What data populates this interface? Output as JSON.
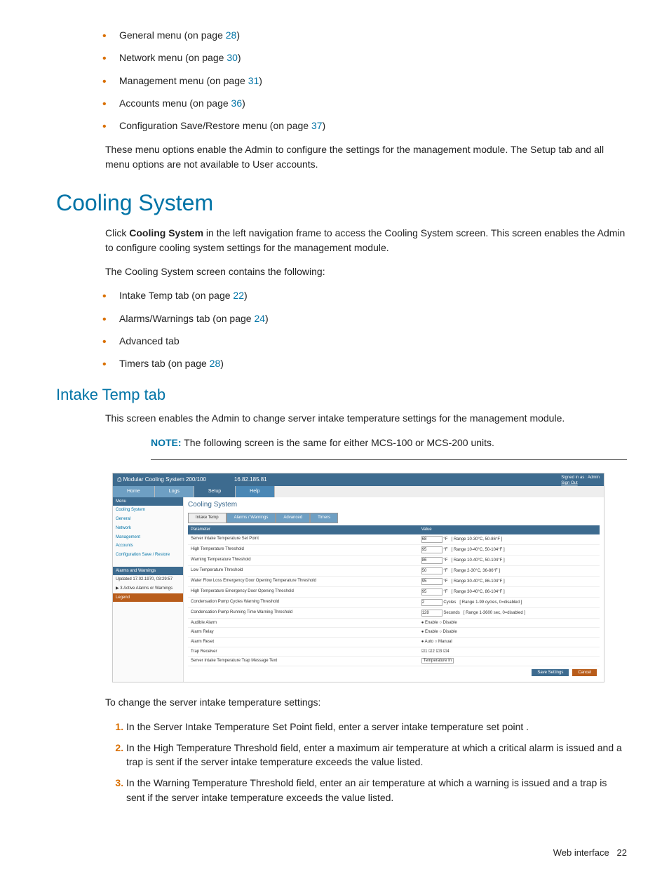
{
  "top_menus": [
    {
      "prefix": "General menu (on page ",
      "page": "28",
      "suffix": ")"
    },
    {
      "prefix": "Network menu (on page ",
      "page": "30",
      "suffix": ")"
    },
    {
      "prefix": "Management menu (on page ",
      "page": "31",
      "suffix": ")"
    },
    {
      "prefix": "Accounts menu (on page ",
      "page": "36",
      "suffix": ")"
    },
    {
      "prefix": "Configuration Save/Restore menu (on page ",
      "page": "37",
      "suffix": ")"
    }
  ],
  "top_para": "These menu options enable the Admin to configure the settings for the management module. The Setup tab and all menu options are not available to User accounts.",
  "h1": "Cooling System",
  "cs_p1_pre": "Click ",
  "cs_p1_bold": "Cooling System",
  "cs_p1_post": " in the left navigation frame to access the Cooling System screen. This screen enables the Admin to configure cooling system settings for the management module.",
  "cs_p2": "The Cooling System screen contains the following:",
  "cs_list": [
    {
      "prefix": "Intake Temp tab (on page ",
      "page": "22",
      "suffix": ")"
    },
    {
      "prefix": "Alarms/Warnings tab (on page ",
      "page": "24",
      "suffix": ")"
    },
    {
      "prefix": "Advanced tab",
      "page": "",
      "suffix": ""
    },
    {
      "prefix": "Timers tab (on page ",
      "page": "28",
      "suffix": ")"
    }
  ],
  "h2": "Intake Temp tab",
  "it_p1": "This screen enables the Admin to change server intake temperature settings for the management module.",
  "note_label": "NOTE:",
  "note_text": "  The following screen is the same for either MCS-100 or MCS-200 units.",
  "post_img": "To change the server intake temperature settings:",
  "steps": [
    "In the Server Intake Temperature Set Point field, enter a server intake temperature set point .",
    "In the High Temperature Threshold field, enter a maximum air temperature at which a critical alarm is issued and a trap is sent if the server intake temperature exceeds the value listed.",
    "In the Warning Temperature Threshold field, enter an air temperature at which a warning is issued and a trap is sent if the server intake temperature exceeds the value listed."
  ],
  "footer_label": "Web interface",
  "footer_page": "22",
  "ss": {
    "product": "Modular Cooling System 200/100",
    "ip": "16.82.185.81",
    "signed": "Signed in as : Admin",
    "signout": "Sign Out",
    "main_tabs": [
      "Home",
      "Logs",
      "Setup",
      "Help"
    ],
    "nav_hdr": "Menu",
    "nav_items": [
      "Cooling System",
      "General",
      "Network",
      "Management",
      "Accounts",
      "Configuration Save / Restore"
    ],
    "aw_hdr": "Alarms and Warnings",
    "aw_updated": "Updated 17.02.1970, 03:29:57",
    "aw_active": "3 Active Alarms or Warnings",
    "aw_legend": "Legend",
    "title": "Cooling System",
    "subtabs": [
      "Intake Temp",
      "Alarms / Warnings",
      "Advanced",
      "Timers"
    ],
    "col_param": "Parameter",
    "col_value": "Value",
    "rows": [
      {
        "p": "Server Intake Temperature Set Point",
        "v": "68",
        "u": "°F",
        "r": "[ Range 10-30°C, 50-86°F ]"
      },
      {
        "p": "High Temperature Threshold",
        "v": "95",
        "u": "°F",
        "r": "[ Range 10-40°C, 50-104°F ]"
      },
      {
        "p": "Warning Temperature Threshold",
        "v": "86",
        "u": "°F",
        "r": "[ Range 10-40°C, 50-104°F ]"
      },
      {
        "p": "Low Temperature Threshold",
        "v": "50",
        "u": "°F",
        "r": "[ Range 2-30°C, 36-86°F ]"
      },
      {
        "p": "Water Flow Loss Emergency Door Opening Temperature Threshold",
        "v": "95",
        "u": "°F",
        "r": "[ Range 30-40°C, 86-104°F ]"
      },
      {
        "p": "High Temperature Emergency Door Opening Threshold",
        "v": "95",
        "u": "°F",
        "r": "[ Range 30-40°C, 86-104°F ]"
      },
      {
        "p": "Condensation Pump Cycles Warning Threshold",
        "v": "2",
        "u": "Cycles",
        "r": "[ Range 1-99 cycles, 0=disabled ]"
      },
      {
        "p": "Condensation Pump Running Time Warning Threshold",
        "v": "128",
        "u": "Seconds",
        "r": "[ Range 1-3600 sec, 0=disabled ]"
      }
    ],
    "radio_rows": [
      {
        "p": "Audible Alarm",
        "opts": "● Enable ○ Disable"
      },
      {
        "p": "Alarm Relay",
        "opts": "● Enable ○ Disable"
      },
      {
        "p": "Alarm Reset",
        "opts": "● Auto ○ Manual"
      },
      {
        "p": "Trap Receiver",
        "opts": "☑1 ☑2 ☑3 ☑4"
      }
    ],
    "last_row": {
      "p": "Server Intake Temperature Trap Message Text",
      "v": "Temperature In"
    },
    "btn_save": "Save Settings",
    "btn_cancel": "Cancel"
  }
}
